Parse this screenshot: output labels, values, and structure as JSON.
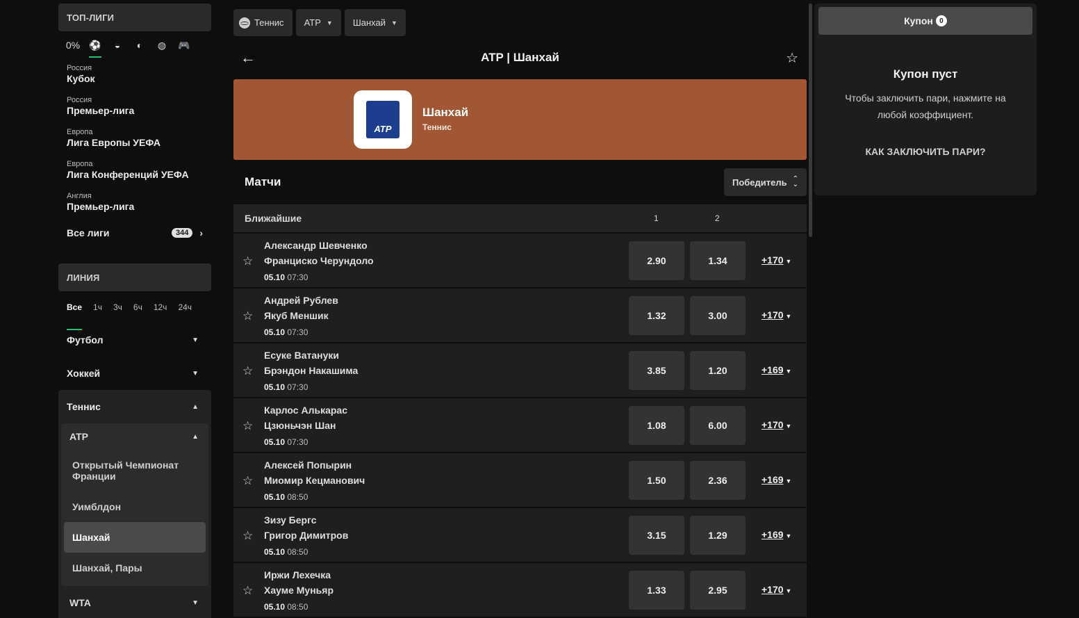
{
  "sidebar": {
    "top_leagues_title": "ТОП-ЛИГИ",
    "sport_icons": [
      {
        "name": "zero-percent-icon",
        "glyph": "0%"
      },
      {
        "name": "soccer-ball-icon",
        "glyph": "⚽"
      },
      {
        "name": "hockey-puck-icon",
        "glyph": "◒"
      },
      {
        "name": "tennis-ball-icon",
        "glyph": "◐"
      },
      {
        "name": "basketball-icon",
        "glyph": "◍"
      },
      {
        "name": "gamepad-icon",
        "glyph": "🎮"
      }
    ],
    "leagues": [
      {
        "region": "Россия",
        "name": "Кубок"
      },
      {
        "region": "Россия",
        "name": "Премьер-лига"
      },
      {
        "region": "Европа",
        "name": "Лига Европы УЕФА"
      },
      {
        "region": "Европа",
        "name": "Лига Конференций УЕФА"
      },
      {
        "region": "Англия",
        "name": "Премьер-лига"
      }
    ],
    "all_leagues_label": "Все лиги",
    "all_leagues_count": "344",
    "line_title": "ЛИНИЯ",
    "time_filters": [
      "Все",
      "1ч",
      "3ч",
      "6ч",
      "12ч",
      "24ч"
    ],
    "sports": {
      "football": "Футбол",
      "hockey": "Хоккей",
      "tennis": "Теннис"
    },
    "atp_label": "ATP",
    "tournaments": [
      "Открытый Чемпионат Франции",
      "Уимблдон",
      "Шанхай",
      "Шанхай, Пары"
    ],
    "selected_tournament": "Шанхай",
    "wta_label": "WTA"
  },
  "breadcrumbs": {
    "sport": "Теннис",
    "category": "ATP",
    "tournament": "Шанхай"
  },
  "page_title": "ATP | Шанхай",
  "banner": {
    "title": "Шанхай",
    "subtitle": "Теннис",
    "logo_text": "ATP",
    "color": "#a15634"
  },
  "matches": {
    "title": "Матчи",
    "market_label": "Победитель",
    "group_label": "Ближайшие",
    "col1": "1",
    "col2": "2",
    "rows": [
      {
        "p1": "Александр Шевченко",
        "p2": "Франциско Черундоло",
        "date": "05.10",
        "time": "07:30",
        "o1": "2.90",
        "o2": "1.34",
        "more": "+170"
      },
      {
        "p1": "Андрей Рублев",
        "p2": "Якуб Меншик",
        "date": "05.10",
        "time": "07:30",
        "o1": "1.32",
        "o2": "3.00",
        "more": "+170"
      },
      {
        "p1": "Есуке Ватануки",
        "p2": "Брэндон Накашима",
        "date": "05.10",
        "time": "07:30",
        "o1": "3.85",
        "o2": "1.20",
        "more": "+169"
      },
      {
        "p1": "Карлос Алькарас",
        "p2": "Цзюньчэн Шан",
        "date": "05.10",
        "time": "07:30",
        "o1": "1.08",
        "o2": "6.00",
        "more": "+170"
      },
      {
        "p1": "Алексей Попырин",
        "p2": "Миомир Кецманович",
        "date": "05.10",
        "time": "08:50",
        "o1": "1.50",
        "o2": "2.36",
        "more": "+169"
      },
      {
        "p1": "Зизу Бергс",
        "p2": "Григор Димитров",
        "date": "05.10",
        "time": "08:50",
        "o1": "3.15",
        "o2": "1.29",
        "more": "+169"
      },
      {
        "p1": "Иржи Лехечка",
        "p2": "Хауме Муньяр",
        "date": "05.10",
        "time": "08:50",
        "o1": "1.33",
        "o2": "2.95",
        "more": "+170"
      }
    ]
  },
  "coupon": {
    "tab_label": "Купон",
    "count": "0",
    "empty_title": "Купон пуст",
    "hint": "Чтобы заключить пари, нажмите на любой коэффициент.",
    "how_to": "КАК ЗАКЛЮЧИТЬ ПАРИ?"
  },
  "colors": {
    "accent": "#27c36b",
    "background": "#0e0e0e"
  }
}
